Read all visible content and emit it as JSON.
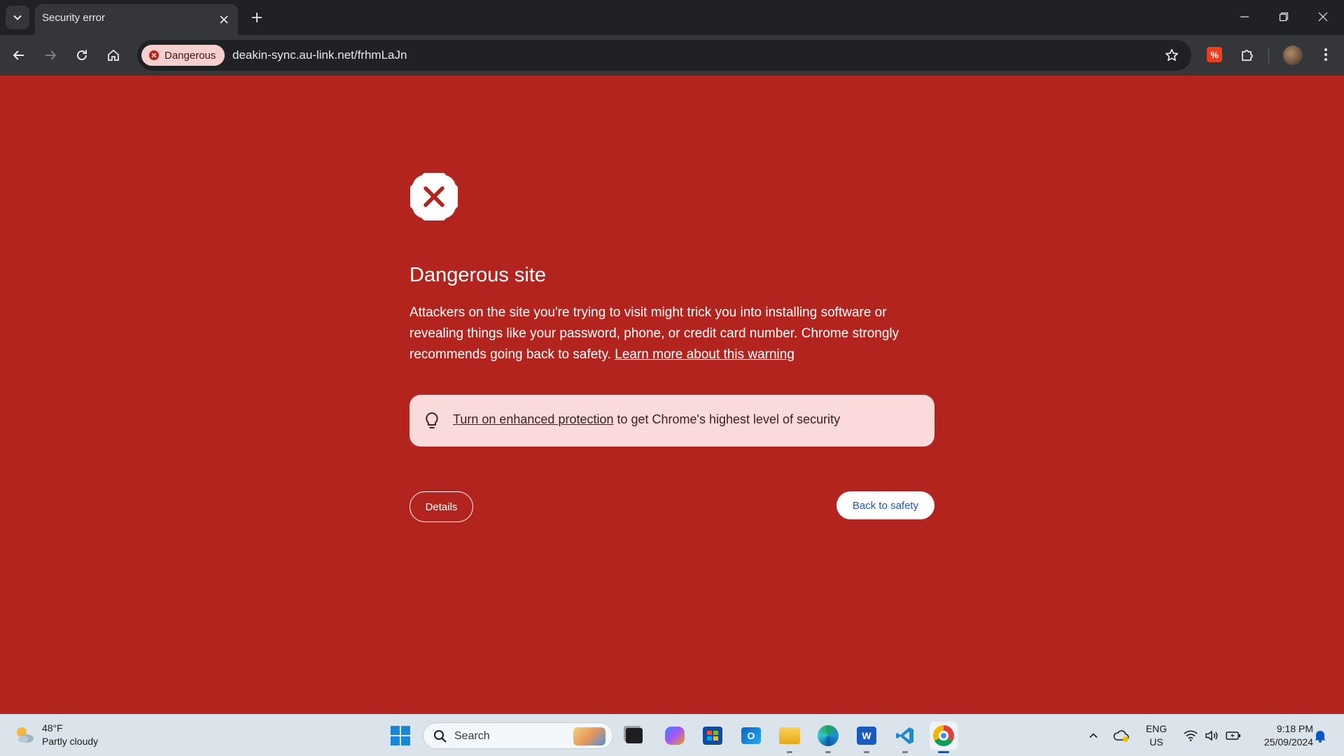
{
  "browser": {
    "tab_title": "Security error",
    "security_chip_label": "Dangerous",
    "url": "deakin-sync.au-link.net/frhmLaJn"
  },
  "page": {
    "headline": "Dangerous site",
    "body_text": "Attackers on the site you're trying to visit might trick you into installing software or revealing things like your password, phone, or credit card number. Chrome strongly recommends going back to safety.",
    "learn_more_link": "Learn more about this warning",
    "enhanced_link": "Turn on enhanced protection",
    "enhanced_suffix": " to get Chrome's highest level of security",
    "details_button": "Details",
    "back_button": "Back to safety"
  },
  "taskbar": {
    "weather_temp": "48°F",
    "weather_desc": "Partly cloudy",
    "search_placeholder": "Search",
    "lang_top": "ENG",
    "lang_bottom": "US",
    "time": "9:18 PM",
    "date": "25/09/2024"
  },
  "colors": {
    "page_background": "#b3241e",
    "chrome_dark": "#202124",
    "chip_background": "#f6cfcf",
    "enhanced_box": "#fadada",
    "link_blue": "#1a57c4"
  },
  "icons": [
    "tab-search-icon",
    "close-icon",
    "plus-icon",
    "minimize-icon",
    "restore-icon",
    "back-icon",
    "forward-icon",
    "reload-icon",
    "home-icon",
    "dangerous-icon",
    "star-icon",
    "extension-icon",
    "puzzle-icon",
    "menu-icon",
    "stop-x-icon",
    "lightbulb-icon",
    "weather-icon",
    "windows-icon",
    "search-icon",
    "chevron-up-icon",
    "wifi-icon",
    "volume-icon",
    "battery-icon",
    "bell-icon"
  ]
}
